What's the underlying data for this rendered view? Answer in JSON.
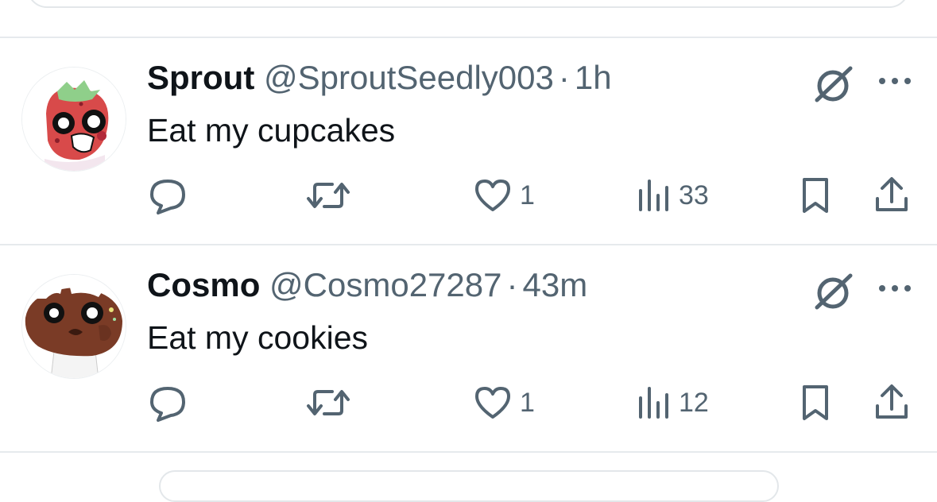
{
  "colors": {
    "secondary_text": "#536471",
    "primary_text": "#0f1419",
    "divider": "#e6eaed"
  },
  "posts": [
    {
      "name": "Sprout",
      "handle": "@SproutSeedly003",
      "separator": "·",
      "time": "1h",
      "text": "Eat my cupcakes",
      "avatar_icon": "strawberry-character-avatar",
      "actions": {
        "replies": "",
        "reposts": "",
        "likes": "1",
        "views": "33"
      }
    },
    {
      "name": "Cosmo",
      "handle": "@Cosmo27287",
      "separator": "·",
      "time": "43m",
      "text": "Eat my cookies",
      "avatar_icon": "cookie-character-avatar",
      "actions": {
        "replies": "",
        "reposts": "",
        "likes": "1",
        "views": "12"
      }
    }
  ]
}
